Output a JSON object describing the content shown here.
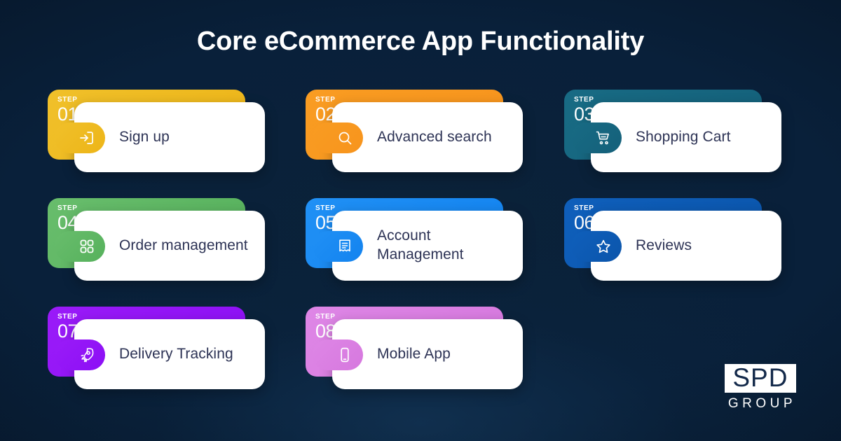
{
  "title": "Core eCommerce App Functionality",
  "background": {
    "color_outer": "#061628",
    "color_inner": "#0b2239"
  },
  "step_word": "STEP",
  "cards": [
    {
      "step": "01",
      "label": "Sign up",
      "icon": "login-icon",
      "color": "#edb518",
      "color2": "#f0c02a"
    },
    {
      "step": "02",
      "label": "Advanced search",
      "icon": "search-icon",
      "color": "#f7941d",
      "color2": "#f99c22"
    },
    {
      "step": "03",
      "label": "Shopping Cart",
      "icon": "shopping-cart-icon",
      "color": "#14607a",
      "color2": "#186b84"
    },
    {
      "step": "04",
      "label": "Order management",
      "icon": "grid-dots-icon",
      "color": "#56b15c",
      "color2": "#68bd6c"
    },
    {
      "step": "05",
      "label": "Account Management",
      "icon": "receipt-icon",
      "color": "#1383ef",
      "color2": "#2090f5"
    },
    {
      "step": "06",
      "label": "Reviews",
      "icon": "star-icon",
      "color": "#0b55ab",
      "color2": "#0f5fbb"
    },
    {
      "step": "07",
      "label": "Delivery Tracking",
      "icon": "rocket-icon",
      "color": "#8c0ff5",
      "color2": "#9a1bf8"
    },
    {
      "step": "08",
      "label": "Mobile App",
      "icon": "mobile-phone-icon",
      "color": "#d678de",
      "color2": "#de86e6"
    }
  ],
  "logo": {
    "mark": "SPD",
    "word": "GROUP"
  }
}
